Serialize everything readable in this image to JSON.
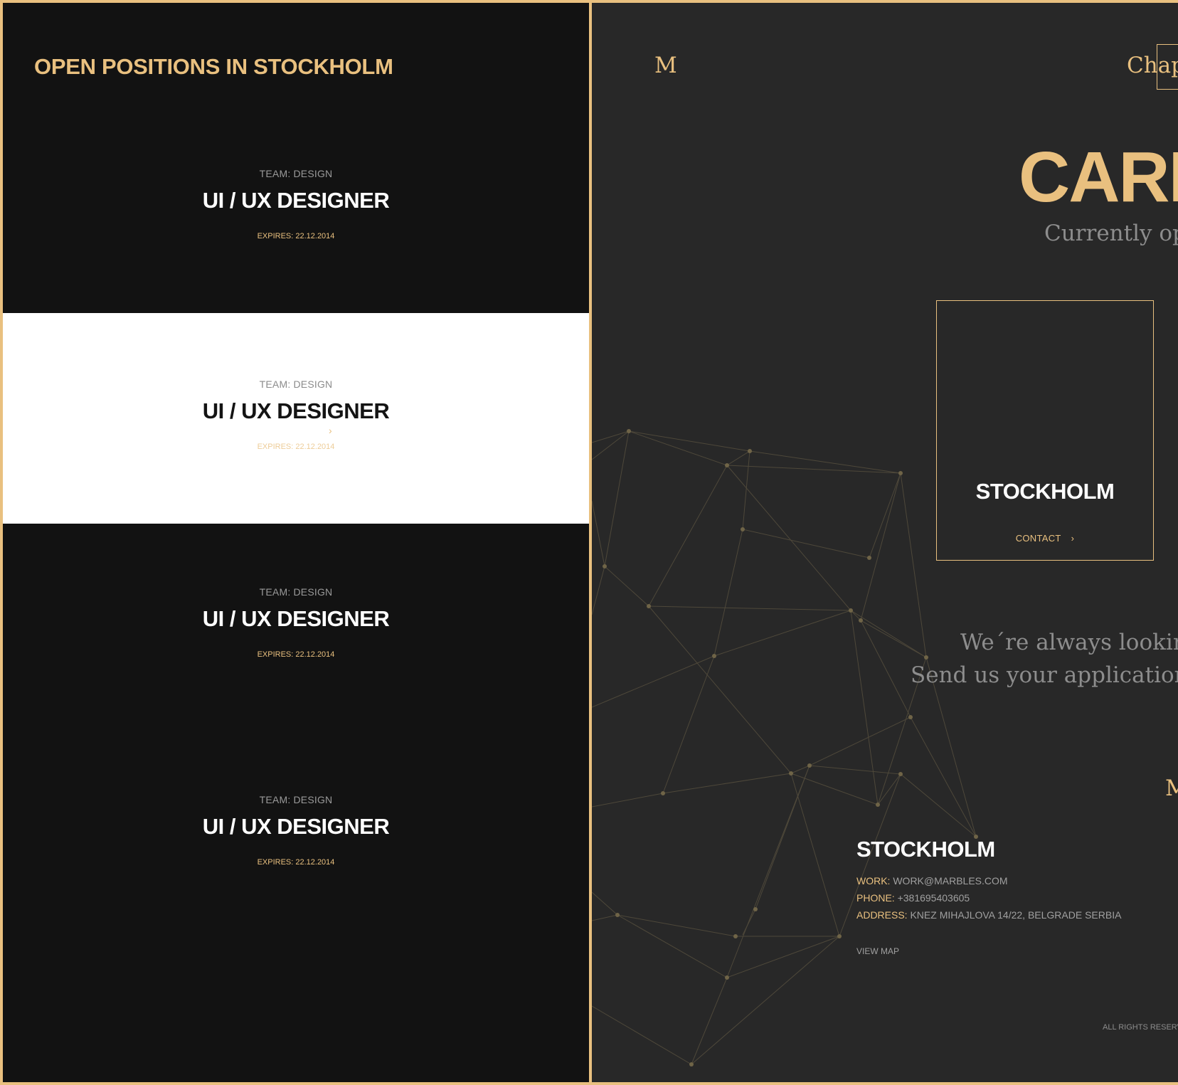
{
  "colors": {
    "accent": "#e9c07f",
    "dark": "#121212",
    "panel": "#282828",
    "light": "#ffffff"
  },
  "left_panel": {
    "title": "OPEN POSITIONS IN STOCKHOLM",
    "jobs": [
      {
        "team": "TEAM: DESIGN",
        "title": "UI / UX DESIGNER",
        "expires": "EXPIRES: 22.12.2014",
        "style": "dark"
      },
      {
        "team": "TEAM: DESIGN",
        "title": "UI / UX DESIGNER",
        "expires": "EXPIRES: 22.12.2014",
        "style": "light",
        "hovered": true
      },
      {
        "team": "TEAM: DESIGN",
        "title": "UI / UX DESIGNER",
        "expires": "EXPIRES: 22.12.2014",
        "style": "dark"
      },
      {
        "team": "TEAM: DESIGN",
        "title": "UI / UX DESIGNER",
        "expires": "EXPIRES: 22.12.2014",
        "style": "dark"
      }
    ],
    "arrow_icon": "›"
  },
  "right_panel": {
    "logo": "M",
    "nav_item": "Chap",
    "heading": "CARE",
    "subtitle": "Currently op",
    "card": {
      "city": "STOCKHOLM",
      "contact_label": "CONTACT",
      "chevron_icon": "›"
    },
    "looking_line1": "We´re always lookin",
    "looking_line2": "Send us your application",
    "edge_letter": "M",
    "contact_info": {
      "city": "STOCKHOLM",
      "work_label": "WORK:",
      "work_value": "WORK@MARBLES.COM",
      "phone_label": "PHONE:",
      "phone_value": "+381695403605",
      "address_label": "ADDRESS:",
      "address_value": "KNEZ MIHAJLOVA 14/22, BELGRADE SERBIA",
      "view_map": "VIEW MAP"
    },
    "rights": "ALL RIGHTS RESERV"
  }
}
